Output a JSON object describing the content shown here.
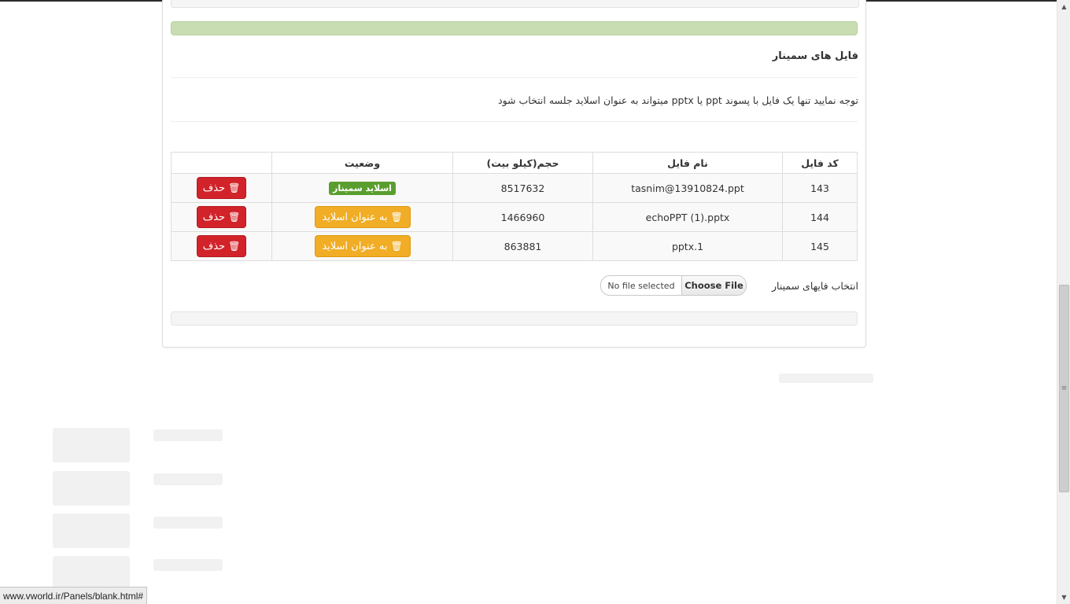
{
  "section": {
    "heading": "فایل های سمینار",
    "note_before": "توجه نمایید تنها یک فایل با پسوند",
    "note_ext1": "ppt",
    "note_middle": "یا",
    "note_ext2": "pptx",
    "note_after": "میتواند به عنوان اسلاید جلسه انتخاب شود"
  },
  "table": {
    "headers": {
      "code": "کد فایل",
      "name": "نام فایل",
      "size": "حجم(کیلو بیت)",
      "status": "وضعیت"
    },
    "rows": [
      {
        "code": "143",
        "name": "tasnim@13910824.ppt",
        "size": "8517632",
        "status_type": "badge",
        "status_label": "اسلاید سمینار",
        "delete_label": "حذف"
      },
      {
        "code": "144",
        "name": "echoPPT (1).pptx",
        "size": "1466960",
        "status_type": "button",
        "status_label": "به عنوان اسلاید",
        "delete_label": "حذف"
      },
      {
        "code": "145",
        "name": "pptx.1",
        "size": "863881",
        "status_type": "button",
        "status_label": "به عنوان اسلاید",
        "delete_label": "حذف"
      }
    ]
  },
  "upload": {
    "label": "انتخاب فایهای سمینار",
    "choose_label": "Choose File",
    "no_file_label": "No file selected"
  },
  "statusbar": {
    "url": "www.vworld.ir/Panels/blank.html#"
  },
  "icons": {
    "trash": "trash-icon"
  },
  "colors": {
    "danger": "#d2232a",
    "warning": "#f0ad25",
    "success": "#5a9e2f",
    "green_bar": "#c9ddb3"
  }
}
